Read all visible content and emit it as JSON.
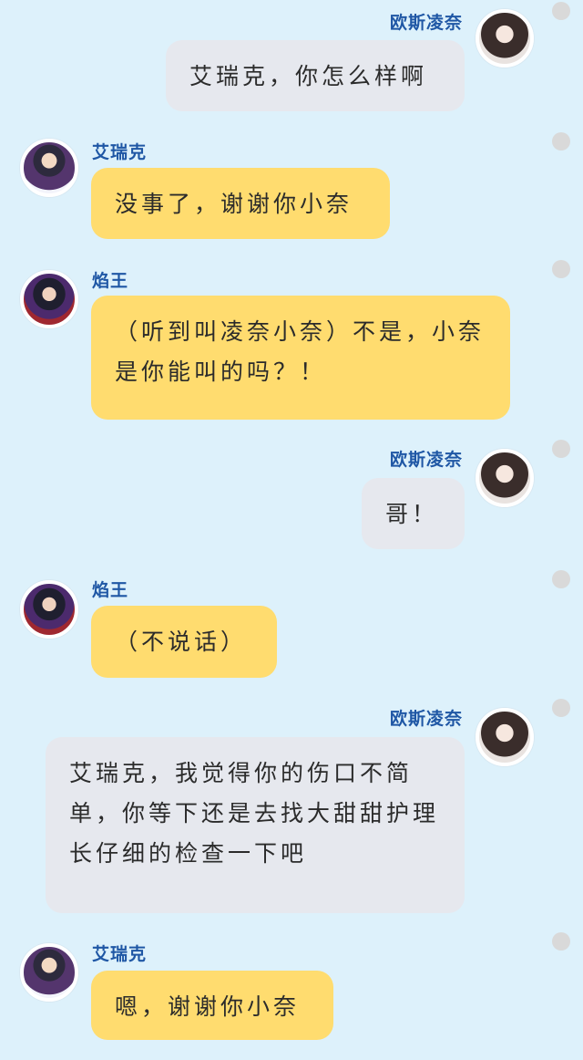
{
  "messages": [
    {
      "sender": "欧斯凌奈",
      "text": "艾瑞克，你怎么样啊"
    },
    {
      "sender": "艾瑞克",
      "text": "没事了，谢谢你小奈"
    },
    {
      "sender": "焰王",
      "text": "（听到叫凌奈小奈）不是，小奈是你能叫的吗？！"
    },
    {
      "sender": "欧斯凌奈",
      "text": "哥！"
    },
    {
      "sender": "焰王",
      "text": "（不说话）"
    },
    {
      "sender": "欧斯凌奈",
      "text": "艾瑞克，我觉得你的伤口不简单，你等下还是去找大甜甜护理长仔细的检查一下吧"
    },
    {
      "sender": "艾瑞克",
      "text": "嗯，谢谢你小奈"
    }
  ],
  "colors": {
    "background": "#ddf1fb",
    "name_text": "#1f57a5",
    "bubble_self": "#e6e8ee",
    "bubble_other": "#ffdc6f",
    "status_dot": "#d9d9d9"
  },
  "icons": [
    "avatar-female",
    "avatar-male",
    "status-dot"
  ]
}
